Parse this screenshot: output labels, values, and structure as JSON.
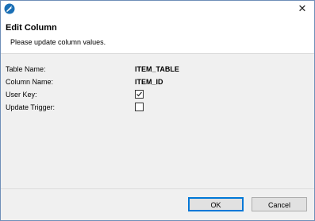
{
  "window": {
    "close_glyph": "✕",
    "accent_color": "#1a6fb5"
  },
  "header": {
    "title": "Edit Column",
    "message": "Please update column values."
  },
  "form": {
    "table_name_label": "Table Name:",
    "table_name_value": "ITEM_TABLE",
    "column_name_label": "Column Name:",
    "column_name_value": "ITEM_ID",
    "user_key_label": "User Key:",
    "user_key_checked": true,
    "update_trigger_label": "Update Trigger:",
    "update_trigger_checked": false
  },
  "buttons": {
    "ok_label": "OK",
    "cancel_label": "Cancel"
  }
}
